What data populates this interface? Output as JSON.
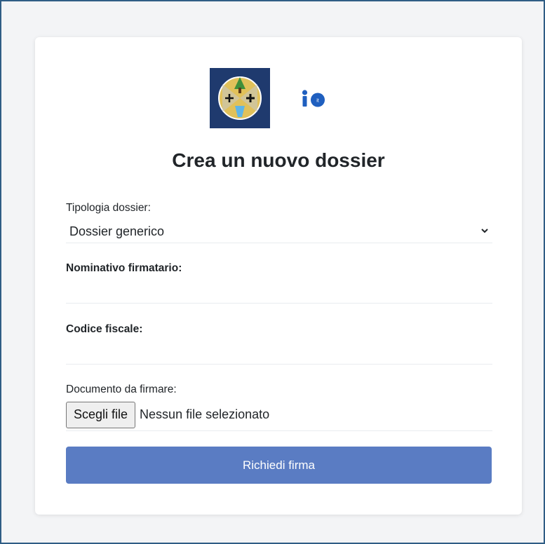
{
  "form": {
    "title": "Crea un nuovo dossier",
    "tipologia_label": "Tipologia dossier:",
    "tipologia_value": "Dossier generico",
    "nominativo_label": "Nominativo firmatario:",
    "nominativo_value": "",
    "codice_label": "Codice fiscale:",
    "codice_value": "",
    "documento_label": "Documento da firmare:",
    "file_button_label": "Scegli file",
    "file_status": "Nessun file selezionato",
    "submit_label": "Richiedi firma"
  },
  "colors": {
    "accent": "#5a7cc3",
    "io_logo": "#1f5fbf",
    "region_logo_bg": "#1f3a6e",
    "region_logo_gold": "#e1c15a"
  },
  "icons": {
    "region_logo": "regione-calabria-emblem",
    "io_logo": "io-app-logo",
    "select_chevron": "chevron-down-icon"
  }
}
